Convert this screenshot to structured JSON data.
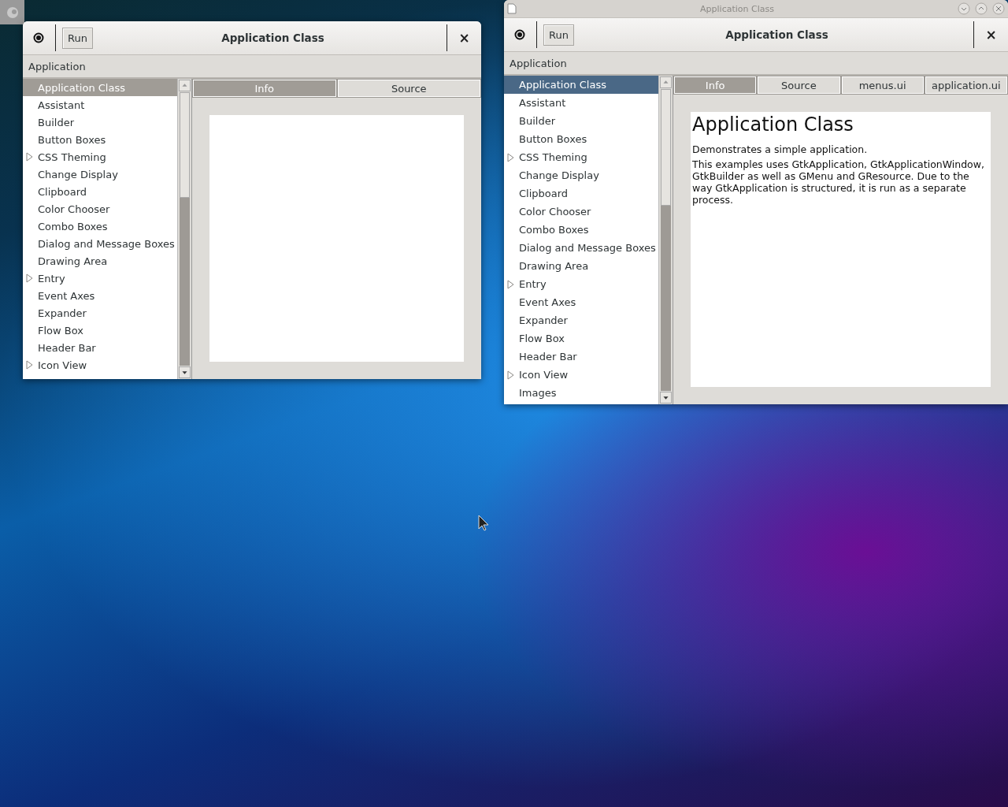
{
  "windows": [
    {
      "focused": false,
      "headerbar": {
        "run_label": "Run",
        "title": "Application Class",
        "close": "×"
      },
      "menubar": {
        "label": "Application"
      },
      "sidebar": {
        "items": [
          {
            "label": "Application Class",
            "kind": "leaf",
            "selected": true
          },
          {
            "label": "Assistant",
            "kind": "leaf",
            "selected": false
          },
          {
            "label": "Builder",
            "kind": "leaf",
            "selected": false
          },
          {
            "label": "Button Boxes",
            "kind": "leaf",
            "selected": false
          },
          {
            "label": "CSS Theming",
            "kind": "group",
            "selected": false
          },
          {
            "label": "Change Display",
            "kind": "leaf",
            "selected": false
          },
          {
            "label": "Clipboard",
            "kind": "leaf",
            "selected": false
          },
          {
            "label": "Color Chooser",
            "kind": "leaf",
            "selected": false
          },
          {
            "label": "Combo Boxes",
            "kind": "leaf",
            "selected": false
          },
          {
            "label": "Dialog and Message Boxes",
            "kind": "leaf",
            "selected": false
          },
          {
            "label": "Drawing Area",
            "kind": "leaf",
            "selected": false
          },
          {
            "label": "Entry",
            "kind": "group",
            "selected": false
          },
          {
            "label": "Event Axes",
            "kind": "leaf",
            "selected": false
          },
          {
            "label": "Expander",
            "kind": "leaf",
            "selected": false
          },
          {
            "label": "Flow Box",
            "kind": "leaf",
            "selected": false
          },
          {
            "label": "Header Bar",
            "kind": "leaf",
            "selected": false
          },
          {
            "label": "Icon View",
            "kind": "group",
            "selected": false
          }
        ]
      },
      "tabs": [
        {
          "label": "Info",
          "selected": true
        },
        {
          "label": "Source",
          "selected": false
        }
      ]
    },
    {
      "focused": true,
      "frame": {
        "title": "Application Class"
      },
      "headerbar": {
        "run_label": "Run",
        "title": "Application Class",
        "close": "×"
      },
      "menubar": {
        "label": "Application"
      },
      "sidebar": {
        "items": [
          {
            "label": "Application Class",
            "kind": "leaf",
            "selected": true
          },
          {
            "label": "Assistant",
            "kind": "leaf",
            "selected": false
          },
          {
            "label": "Builder",
            "kind": "leaf",
            "selected": false
          },
          {
            "label": "Button Boxes",
            "kind": "leaf",
            "selected": false
          },
          {
            "label": "CSS Theming",
            "kind": "group",
            "selected": false
          },
          {
            "label": "Change Display",
            "kind": "leaf",
            "selected": false
          },
          {
            "label": "Clipboard",
            "kind": "leaf",
            "selected": false
          },
          {
            "label": "Color Chooser",
            "kind": "leaf",
            "selected": false
          },
          {
            "label": "Combo Boxes",
            "kind": "leaf",
            "selected": false
          },
          {
            "label": "Dialog and Message Boxes",
            "kind": "leaf",
            "selected": false
          },
          {
            "label": "Drawing Area",
            "kind": "leaf",
            "selected": false
          },
          {
            "label": "Entry",
            "kind": "group",
            "selected": false
          },
          {
            "label": "Event Axes",
            "kind": "leaf",
            "selected": false
          },
          {
            "label": "Expander",
            "kind": "leaf",
            "selected": false
          },
          {
            "label": "Flow Box",
            "kind": "leaf",
            "selected": false
          },
          {
            "label": "Header Bar",
            "kind": "leaf",
            "selected": false
          },
          {
            "label": "Icon View",
            "kind": "group",
            "selected": false
          },
          {
            "label": "Images",
            "kind": "leaf",
            "selected": false
          }
        ]
      },
      "tabs": [
        {
          "label": "Info",
          "selected": true
        },
        {
          "label": "Source",
          "selected": false
        },
        {
          "label": "menus.ui",
          "selected": false
        },
        {
          "label": "application.ui",
          "selected": false
        }
      ],
      "content": {
        "heading": "Application Class",
        "paragraphs": [
          "Demonstrates a simple application.",
          "This examples uses GtkApplication, GtkApplicationWindow, GtkBuilder as well as GMenu and GResource. Due to the way GtkApplication is structured, it is run as a separate process."
        ]
      }
    }
  ]
}
